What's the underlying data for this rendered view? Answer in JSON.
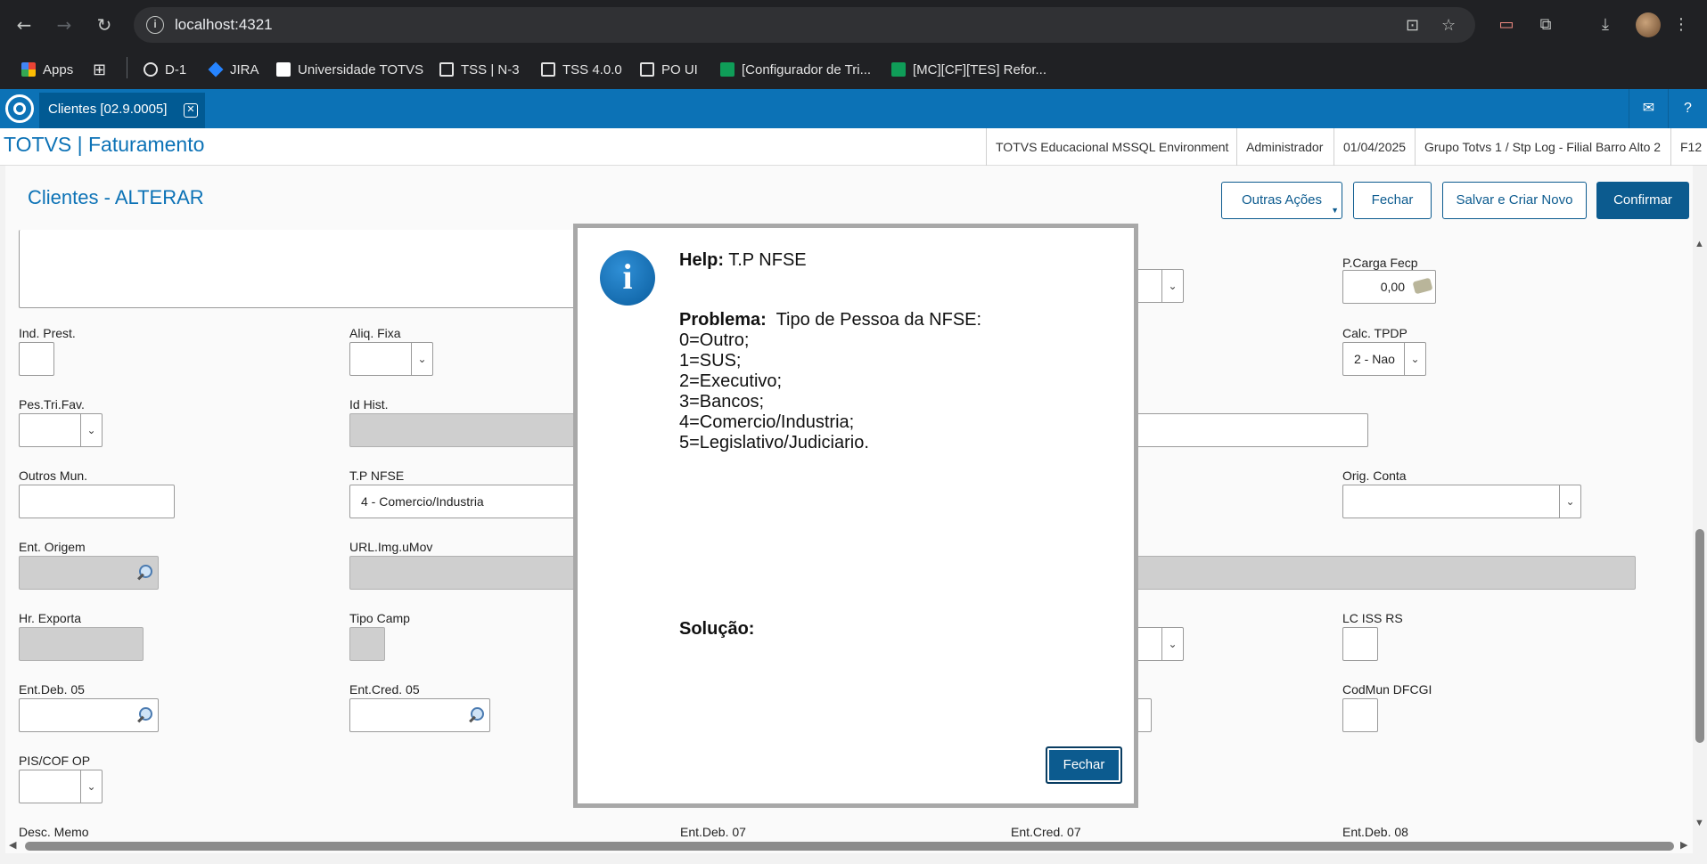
{
  "browser": {
    "url": "localhost:4321",
    "bookmarks": [
      "Apps",
      "D-1",
      "JIRA",
      "Universidade TOTVS",
      "TSS | N-3",
      "TSS 4.0.0",
      "PO UI",
      "[Configurador de Tri...",
      "[MC][CF][TES] Refor..."
    ]
  },
  "app": {
    "tab_label": "Clientes [02.9.0005]",
    "title": "TOTVS | Faturamento",
    "status": [
      "TOTVS Educacional MSSQL Environment",
      "Administrador",
      "01/04/2025",
      "Grupo Totvs 1 / Stp Log - Filial Barro Alto 2",
      "F12"
    ]
  },
  "form": {
    "title": "Clientes - ALTERAR",
    "buttons": {
      "other_actions": "Outras Ações",
      "close": "Fechar",
      "save_new": "Salvar e Criar Novo",
      "confirm": "Confirmar"
    },
    "fields": {
      "ind_prest": "Ind. Prest.",
      "aliq_fixa": "Aliq. Fixa",
      "pes_tri_fav": "Pes.Tri.Fav.",
      "id_hist": "Id Hist.",
      "outros_mun": "Outros Mun.",
      "tp_nfse": "T.P NFSE",
      "tp_nfse_value": "4 - Comercio/Industria",
      "ent_origem": "Ent. Origem",
      "url_img_umov": "URL.Img.uMov",
      "hr_exporta": "Hr. Exporta",
      "tipo_camp": "Tipo Camp",
      "ent_deb_05": "Ent.Deb. 05",
      "ent_cred_05": "Ent.Cred. 05",
      "pis_cof_op": "PIS/COF OP",
      "desc_memo": "Desc. Memo",
      "ent_deb_07": "Ent.Deb. 07",
      "ent_cred_07": "Ent.Cred. 07",
      "ent_deb_08": "Ent.Deb. 08",
      "p_carga_fecp": "P.Carga Fecp",
      "p_carga_fecp_value": "0,00",
      "calc_tpdp": "Calc. TPDP",
      "calc_tpdp_value": "2 - Nao",
      "orig_conta": "Orig. Conta",
      "lc_iss_rs": "LC ISS RS",
      "codmun_dfcgi": "CodMun DFCGI"
    }
  },
  "modal": {
    "help_label": "Help:",
    "help_field": "T.P NFSE",
    "problem_label": "Problema:",
    "problem_title": "Tipo de Pessoa da NFSE:",
    "problem_lines": [
      "0=Outro;",
      "1=SUS;",
      "2=Executivo;",
      "3=Bancos;",
      "4=Comercio/Industria;",
      "5=Legislativo/Judiciario."
    ],
    "solution_label": "Solução:",
    "close_label": "Fechar"
  }
}
